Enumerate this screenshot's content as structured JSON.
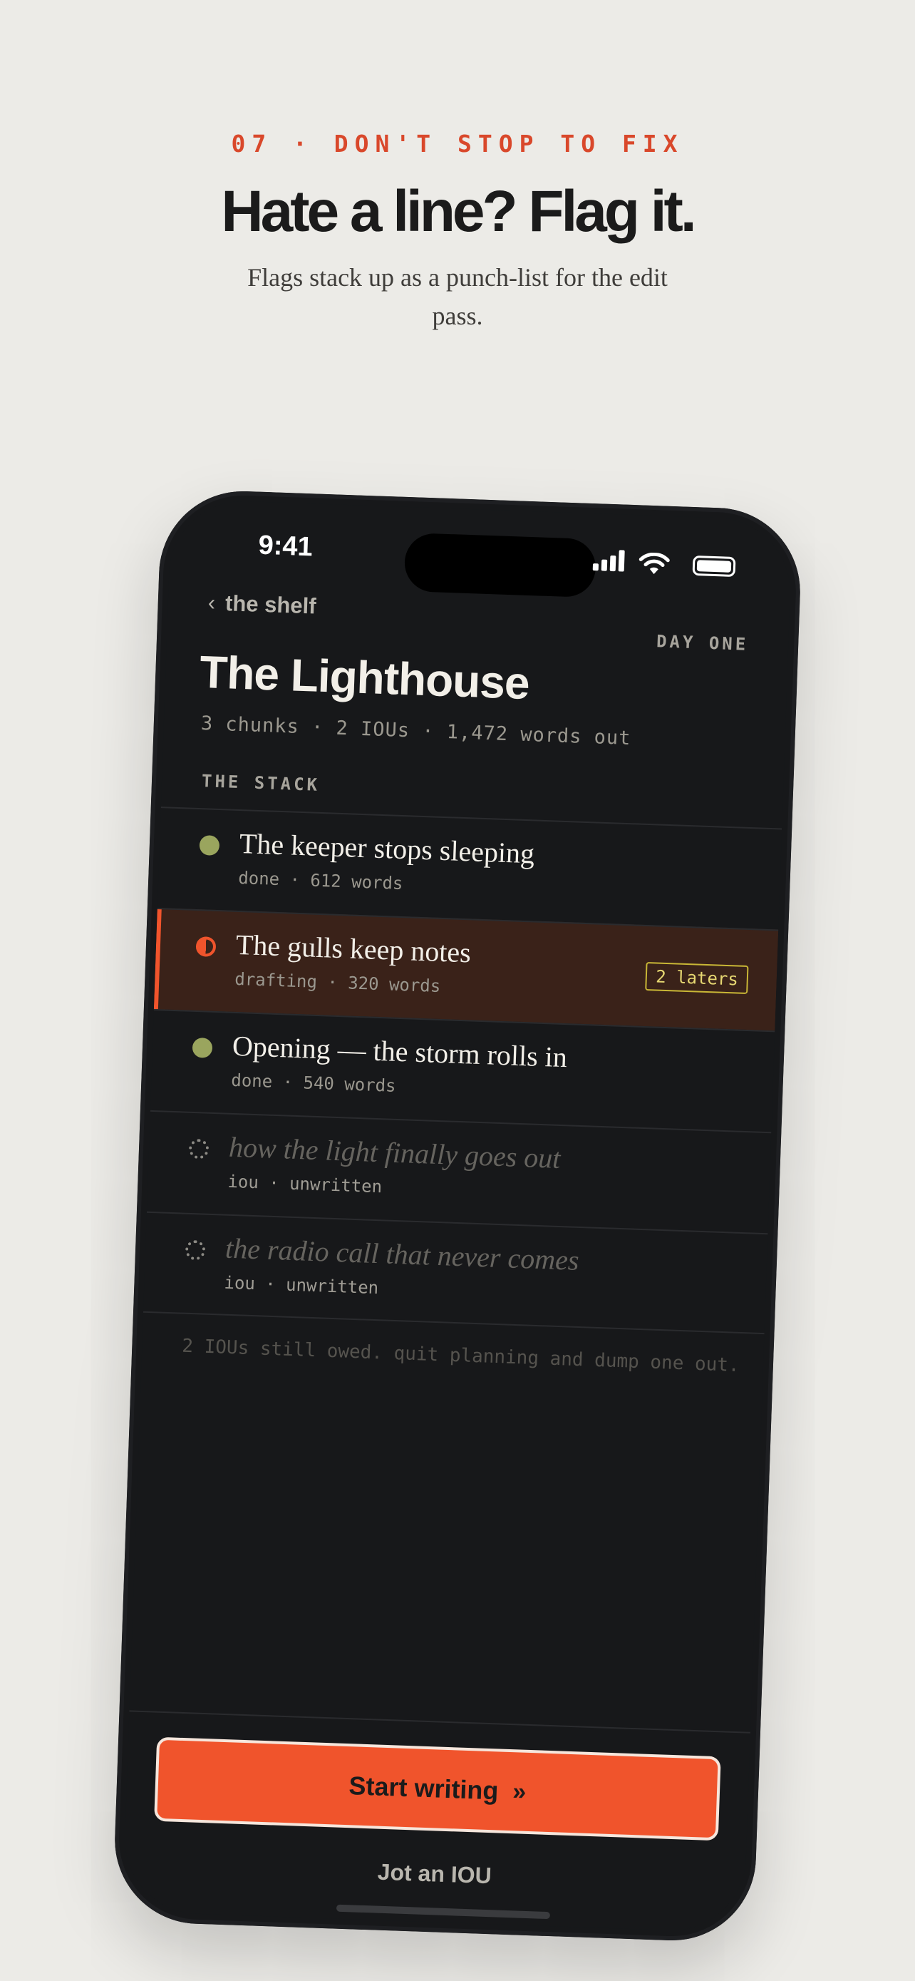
{
  "hero": {
    "eyebrow": "07 · DON'T STOP TO FIX",
    "headline": "Hate a line? Flag it.",
    "subtitle": "Flags stack up as a punch-list for the edit pass."
  },
  "status_bar": {
    "time": "9:41",
    "icons": [
      "signal-icon",
      "wifi-icon",
      "battery-icon"
    ]
  },
  "nav": {
    "back_label": "the shelf",
    "back_icon": "chevron-left-icon",
    "day_label": "DAY ONE"
  },
  "project": {
    "title": "The Lighthouse",
    "meta": "3 chunks · 2 IOUs · 1,472 words out"
  },
  "stack": {
    "label": "THE STACK",
    "items": [
      {
        "title": "The keeper stops sleeping",
        "sub": "done · 612 words",
        "state": "done"
      },
      {
        "title": "The gulls keep notes",
        "sub": "drafting · 320 words",
        "state": "drafting",
        "badge": "2 laters"
      },
      {
        "title": "Opening — the storm rolls in",
        "sub": "done · 540 words",
        "state": "done"
      },
      {
        "title": "how the light finally goes out",
        "sub": "iou · unwritten",
        "state": "iou"
      },
      {
        "title": "the radio call that never comes",
        "sub": "iou · unwritten",
        "state": "iou"
      }
    ],
    "hint": "2 IOUs still owed. quit planning and dump one out."
  },
  "actions": {
    "primary": "Start writing",
    "primary_icon": "double-chevron-right-icon",
    "secondary": "Jot an IOU"
  },
  "colors": {
    "accent": "#f0542c",
    "done": "#9aa55e",
    "badge": "#c9b736",
    "background": "#ecebe7",
    "phone": "#17181a"
  }
}
